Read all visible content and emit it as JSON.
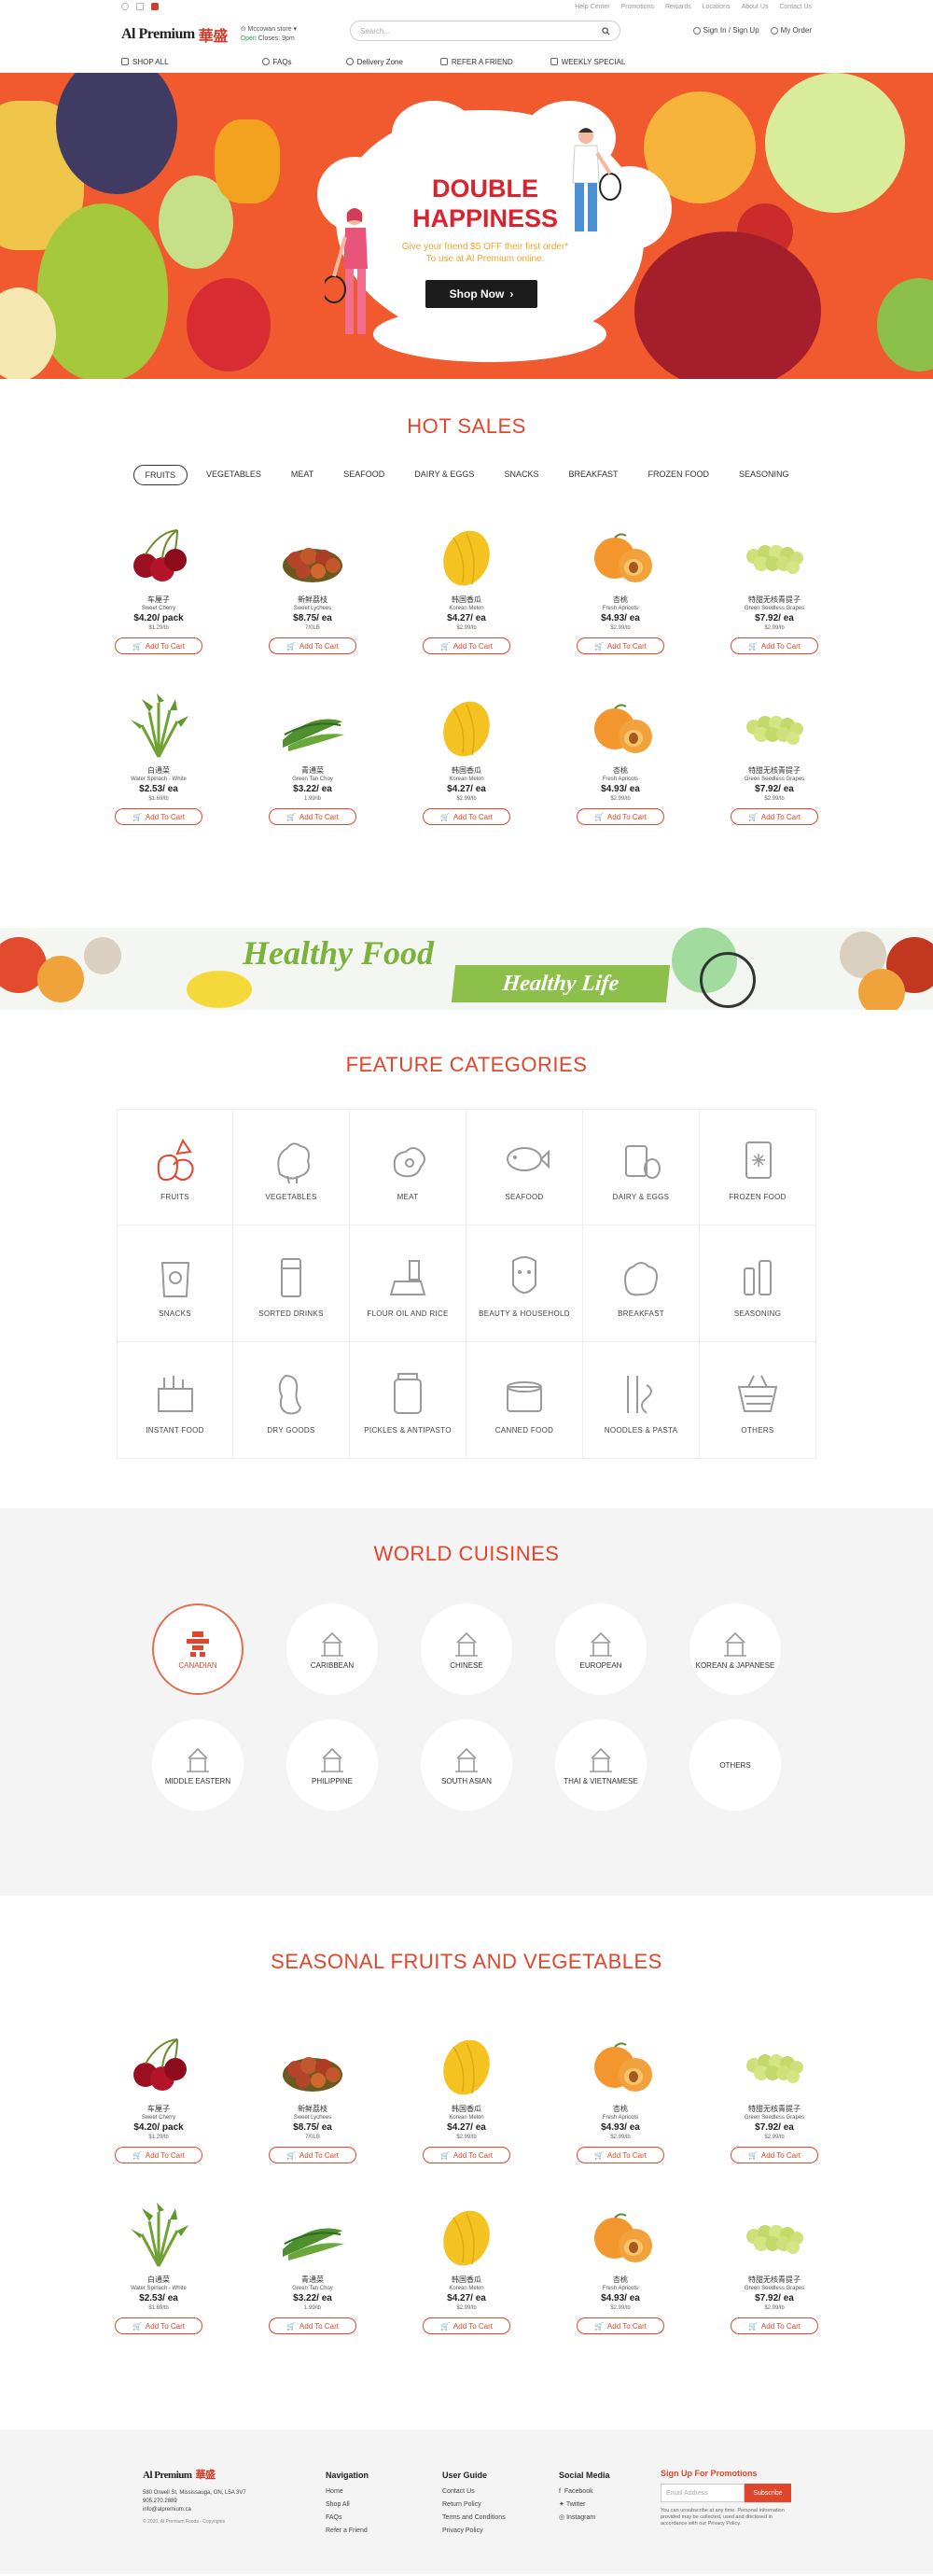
{
  "topbar": {
    "links": [
      "Help Center",
      "Promotions",
      "Rewards",
      "Locations",
      "About Us",
      "Contact Us"
    ]
  },
  "header": {
    "logo_text": "Al Premium",
    "logo_cn": "華盛",
    "store_name": "Mccowan store",
    "store_status": "Open",
    "store_hours": "Closes: 9pm",
    "search_placeholder": "Search...",
    "signin": "Sign In / Sign Up",
    "my_order": "My Order"
  },
  "nav": {
    "items": [
      "SHOP ALL",
      "FAQs",
      "Delivery Zone",
      "REFER A FRIEND",
      "WEEKLY SPECIAL"
    ]
  },
  "hero": {
    "title_line1": "DOUBLE",
    "title_line2": "HAPPINESS",
    "subtitle_line1": "Give your friend $5 OFF their first order*",
    "subtitle_line2": "To use at Al Premium online.",
    "cta": "Shop Now"
  },
  "hot_sales": {
    "title": "HOT SALES",
    "tabs": [
      "FRUITS",
      "VEGETABLES",
      "MEAT",
      "SEAFOOD",
      "DAIRY & EGGS",
      "SNACKS",
      "BREAKFAST",
      "FROZEN FOOD",
      "SEASONING"
    ],
    "active_tab": "FRUITS"
  },
  "products": [
    {
      "cn": "车厘子",
      "en": "Sweet Cherry",
      "price": "$4.20/ pack",
      "unit": "$1.29/lb",
      "img": "cherry"
    },
    {
      "cn": "新鲜荔枝",
      "en": "Sweet Lychees",
      "price": "$8.75/ ea",
      "unit": "7/0LB",
      "img": "lychee"
    },
    {
      "cn": "韩国香瓜",
      "en": "Korean Melon",
      "price": "$4.27/ ea",
      "unit": "$2.99/lb",
      "img": "melon"
    },
    {
      "cn": "杏桃",
      "en": "Fresh Apricots",
      "price": "$4.93/ ea",
      "unit": "$2.99/lb",
      "img": "apricot"
    },
    {
      "cn": "特甜无核青提子",
      "en": "Green Seedless Grapes",
      "price": "$7.92/ ea",
      "unit": "$2.99/lb",
      "img": "grape"
    },
    {
      "cn": "白通菜",
      "en": "Water Spinach - White",
      "price": "$2.53/ ea",
      "unit": "$1.69/lb",
      "img": "spinach"
    },
    {
      "cn": "青通菜",
      "en": "Green Tan Choy",
      "price": "$3.22/ ea",
      "unit": "1.99/lb",
      "img": "tanchoy"
    },
    {
      "cn": "韩国香瓜",
      "en": "Korean Melon",
      "price": "$4.27/ ea",
      "unit": "$2.99/lb",
      "img": "melon"
    },
    {
      "cn": "杏桃",
      "en": "Fresh Apricots",
      "price": "$4.93/ ea",
      "unit": "$2.99/lb",
      "img": "apricot"
    },
    {
      "cn": "特甜无核青提子",
      "en": "Green Seedless Grapes",
      "price": "$7.92/ ea",
      "unit": "$2.99/lb",
      "img": "grape"
    }
  ],
  "add_to_cart": "Add To Cart",
  "banner": {
    "line1": "Healthy Food",
    "line2": "Healthy Life"
  },
  "feature_categories": {
    "title": "FEATURE CATEGORIES",
    "items": [
      "FRUITS",
      "VEGETABLES",
      "MEAT",
      "SEAFOOD",
      "DAIRY & EGGS",
      "FROZEN FOOD",
      "SNACKS",
      "SORTED DRINKS",
      "FLOUR OIL AND RICE",
      "BEAUTY & HOUSEHOLD",
      "BREAKFAST",
      "SEASONING",
      "INSTANT FOOD",
      "DRY GOODS",
      "PICKLES & ANTIPASTO",
      "CANNED FOOD",
      "NOODLES & PASTA",
      "OTHERS"
    ]
  },
  "world_cuisines": {
    "title": "WORLD CUISINES",
    "row1": [
      "CANADIAN",
      "CARIBBEAN",
      "CHINESE",
      "EUROPEAN",
      "KOREAN & JAPANESE"
    ],
    "row2": [
      "MIDDLE EASTERN",
      "PHILIPPINE",
      "SOUTH ASIAN",
      "THAI & VIETNAMESE",
      "OTHERS"
    ]
  },
  "seasonal": {
    "title": "SEASONAL FRUITS AND VEGETABLES"
  },
  "footer": {
    "address": "580 Orwell St, Mississauga, ON, L5A 3V7",
    "phone": "905.270.2889",
    "email": "info@alpremium.ca",
    "copyright": "© 2020, Al Premium Foods - Copyrights",
    "nav_title": "Navigation",
    "nav_links": [
      "Home",
      "Shop All",
      "FAQs",
      "Refer a Friend"
    ],
    "guide_title": "User Guide",
    "guide_links": [
      "Contact Us",
      "Return Policy",
      "Terms and Conditions",
      "Privacy Policy"
    ],
    "social_title": "Social Media",
    "social_links": [
      "Facebook",
      "Twitter",
      "Instagram"
    ],
    "promo_title": "Sign Up For Promotions",
    "email_placeholder": "Email Address",
    "subscribe": "Subscribe",
    "disclaimer": "You can unsubscribe at any time. Personal information provided may be collected, used and disclosed in accordance with our Privacy Policy."
  },
  "colors": {
    "accent": "#e0462b",
    "hero_bg": "#f05a2e",
    "banner_green": "#8cc04a"
  }
}
